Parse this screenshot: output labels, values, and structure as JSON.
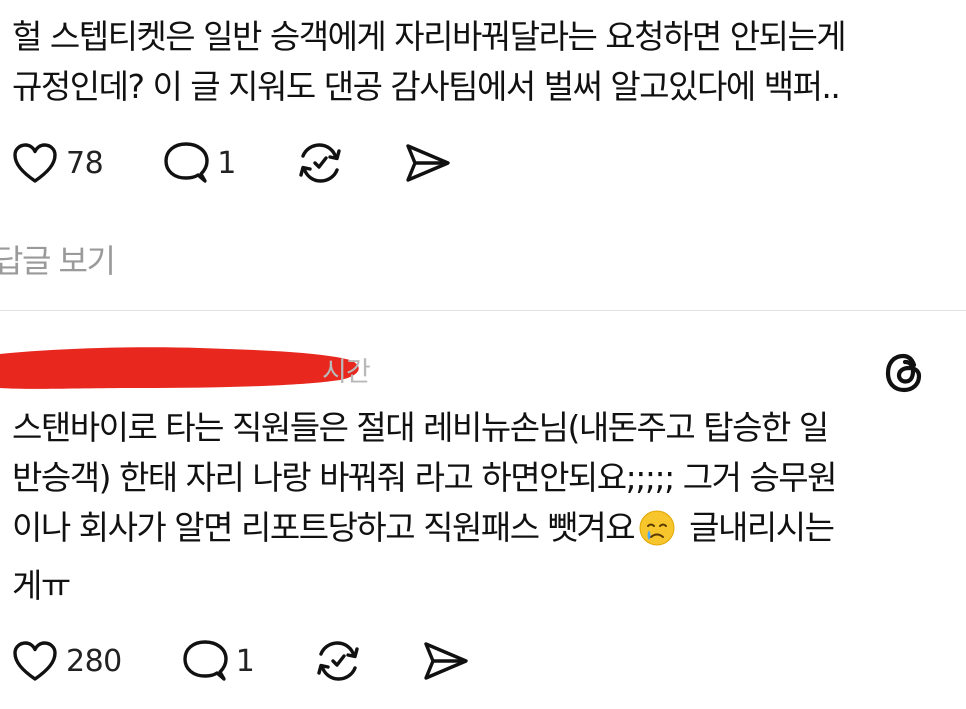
{
  "post1": {
    "lines": [
      "헐 스텝티켓은 일반 승객에게 자리바꿔달라는 요청하면 안되는게",
      "규정인데? 이 글 지워도 댄공 감사팀에서 벌써 알고있다에 백퍼.."
    ],
    "likes": "78",
    "replies": "1"
  },
  "view_replies": "답글 보기",
  "post2": {
    "timestamp": "시간",
    "lines": [
      "스탠바이로 타는 직원들은 절대 레비뉴손님(내돈주고 탑승한 일",
      "반승객) 한태 자리 나랑 바꿔줘 라고 하면안되요;;;;; 그거 승무원",
      "이나 회사가 알면 리포트당하고 직원패스 뺏겨요"
    ],
    "line3_tail": "글내리시는",
    "line4": "게ㅠ",
    "likes": "280",
    "replies": "1"
  },
  "icons": {
    "like": "heart-icon",
    "reply": "comment-icon",
    "repost": "repost-icon",
    "share": "send-icon",
    "brand": "threads-logo-icon",
    "emoji": "crying-face-emoji"
  },
  "colors": {
    "redaction": "#e8281e",
    "muted_text": "#9a9a9a"
  }
}
